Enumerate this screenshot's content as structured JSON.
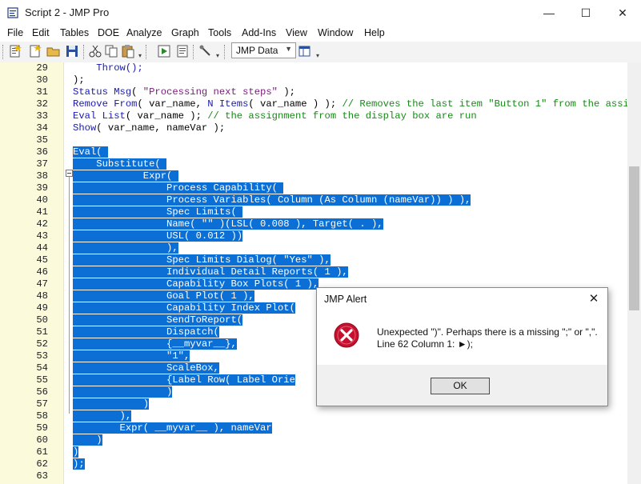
{
  "window": {
    "title": "Script 2 - JMP Pro"
  },
  "title_controls": {
    "minimize": "—",
    "maximize": "☐",
    "close": "✕"
  },
  "menu": [
    "File",
    "Edit",
    "Tables",
    "DOE",
    "Analyze",
    "Graph",
    "Tools",
    "Add-Ins",
    "View",
    "Window",
    "Help"
  ],
  "toolbar": {
    "combo_value": "JMP Data"
  },
  "editor": {
    "line_numbers": [
      "29",
      "30",
      "31",
      "32",
      "33",
      "34",
      "35",
      "36",
      "37",
      "38",
      "39",
      "40",
      "41",
      "42",
      "43",
      "44",
      "45",
      "46",
      "47",
      "48",
      "49",
      "50",
      "51",
      "52",
      "53",
      "54",
      "55",
      "56",
      "57",
      "58",
      "59",
      "60",
      "61",
      "62",
      "63"
    ]
  },
  "code": {
    "l29": "    Throw();",
    "l30": ");",
    "l31a": "Status Msg",
    "l31b": "( ",
    "l31c": "\"Processing next steps\"",
    "l31d": " );",
    "l32a": "Remove From",
    "l32b": "( var_name, ",
    "l32c": "N Items",
    "l32d": "( var_name ) ); ",
    "l32e": "// Removes the last item \"Button 1\" from the assi",
    "l33a": "Eval List",
    "l33b": "( var_name ); ",
    "l33c": "// the assignment from the display box are run",
    "l34a": "Show",
    "l34b": "( var_name, nameVar );",
    "l36": "Eval( ",
    "l37": "    Substitute( ",
    "l38": "            Expr( ",
    "l39": "                Process Capability( ",
    "l40": "                Process Variables( Column (As Column (nameVar)) ) ),",
    "l41": "                Spec Limits( ",
    "l42": "                Name( \"\" )(LSL( 0.008 ), Target( . ),",
    "l43": "                USL( 0.012 ))",
    "l44": "                ),",
    "l45": "                Spec Limits Dialog( \"Yes\" ),",
    "l46": "                Individual Detail Reports( 1 ),",
    "l47": "                Capability Box Plots( 1 ),",
    "l48": "                Goal Plot( 1 ),",
    "l49": "                Capability Index Plot(",
    "l50": "                SendToReport(",
    "l51": "                Dispatch(",
    "l52": "                {__myvar__},",
    "l53": "                \"1\",",
    "l54": "                ScaleBox,",
    "l55": "                {Label Row( Label Orie",
    "l56": "                )",
    "l57": "            )",
    "l58": "        ),",
    "l59": "        Expr( __myvar__ ), nameVar",
    "l60": "    )",
    "l61": ")",
    "l62": ");"
  },
  "dialog": {
    "title": "JMP Alert",
    "close": "✕",
    "message_line1": "Unexpected \")\". Perhaps there is a missing \";\" or \",\".",
    "message_line2": "Line 62 Column 1: ►);",
    "ok_label": "OK"
  },
  "icons": [
    "script-icon",
    "new-icon",
    "open-icon",
    "save-icon",
    "cut-icon",
    "copy-icon",
    "paste-icon",
    "run-icon",
    "debug-icon",
    "tools-icon",
    "table-icon",
    "error-icon"
  ],
  "colors": {
    "selection": "#0b6fd6",
    "keyword": "#1a1ab0",
    "string": "#7a1a7a",
    "comment": "#178a17",
    "gutter": "#fbfbdc"
  }
}
